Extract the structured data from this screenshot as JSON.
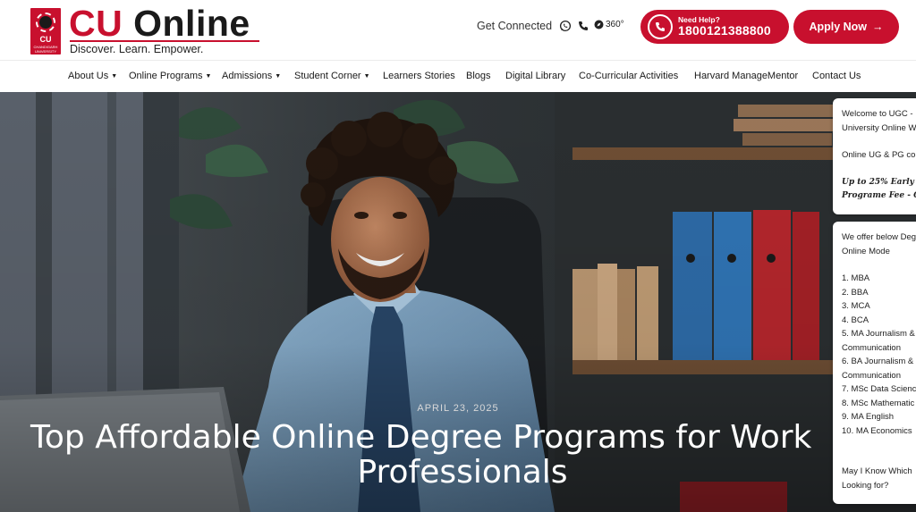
{
  "header": {
    "logo_cu": "CU",
    "logo_online": "Online",
    "logo_tagline": "Discover. Learn. Empower.",
    "emblem_text": "CU",
    "emblem_small": "CHANDIGARH UNIVERSITY",
    "get_connected": "Get Connected",
    "view_360": "360°",
    "help": {
      "label": "Need Help?",
      "number": "1800121388800"
    },
    "apply_label": "Apply Now",
    "accent_color": "#c8102e"
  },
  "nav": {
    "items": [
      {
        "label": "About Us",
        "dropdown": true
      },
      {
        "label": "Online Programs",
        "dropdown": true
      },
      {
        "label": "Admissions",
        "dropdown": true
      },
      {
        "label": "Student Corner",
        "dropdown": true
      },
      {
        "label": "Learners Stories",
        "dropdown": false
      },
      {
        "label": "Blogs",
        "dropdown": false
      },
      {
        "label": "Digital Library",
        "dropdown": false
      },
      {
        "label": "Co-Curricular Activities",
        "dropdown": false
      },
      {
        "label": "Harvard ManageMentor",
        "dropdown": false
      },
      {
        "label": "Contact Us",
        "dropdown": false
      }
    ]
  },
  "hero": {
    "date": "APRIL 23, 2025",
    "title_line1": "Top Affordable Online Degree Programs for Work",
    "title_line2": "Professionals"
  },
  "chat": {
    "card1": {
      "line1": "Welcome to UGC -",
      "line2": "University Online W",
      "line3": "Online UG & PG co",
      "line4": "Up to 25% Early B",
      "line5": "Programe Fee - C"
    },
    "card2": {
      "intro1": "We offer below Deg",
      "intro2": "Online Mode",
      "programs": [
        "1. MBA",
        "2. BBA",
        "3. MCA",
        "4. BCA",
        "5. MA Journalism &",
        "Communication",
        "6. BA Journalism &",
        "Communication",
        "7. MSc Data Scienc",
        "8. MSc Mathematic",
        "9. MA English",
        "10. MA Economics"
      ],
      "question1": "May I Know Which",
      "question2": "Looking for?"
    }
  }
}
